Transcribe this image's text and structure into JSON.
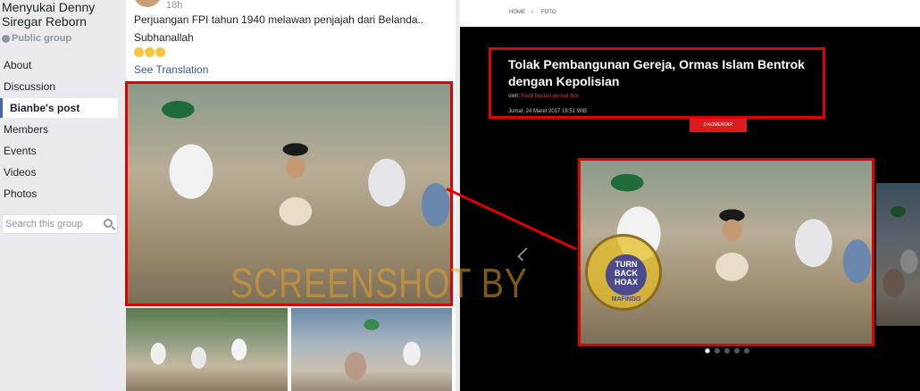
{
  "group": {
    "name": "Menyukai Denny Siregar Reborn",
    "privacy": "Public group",
    "nav": [
      "About",
      "Discussion",
      "Bianbe's post",
      "Members",
      "Events",
      "Videos",
      "Photos"
    ],
    "active_nav": "Bianbe's post",
    "search_placeholder": "Search this group"
  },
  "post": {
    "timestamp": "18h",
    "text": "Perjuangan FPI tahun 1940 melawan penjajah dari Belanda..",
    "exclamation": "Subhanallah",
    "see_translation": "See Translation"
  },
  "watermark": "SCREENSHOT BY",
  "news": {
    "breadcrumb": [
      "HOME",
      "FOTO"
    ],
    "title": "Tolak Pembangunan Gereja, Ormas Islam Bentrok dengan Kepolisian",
    "by_label": "oleh:",
    "author": "Fardi bestari periset foto",
    "date": "Jumat, 24 Maret 2017 18:51 WIB",
    "comments": "0 KOMENTAR"
  },
  "stamp": {
    "inner": "TURN BACK HOAX",
    "bottom": "MAFINDO"
  },
  "colors": {
    "highlight": "#e00000",
    "fb_link": "#385898",
    "news_accent": "#d71d1d"
  }
}
